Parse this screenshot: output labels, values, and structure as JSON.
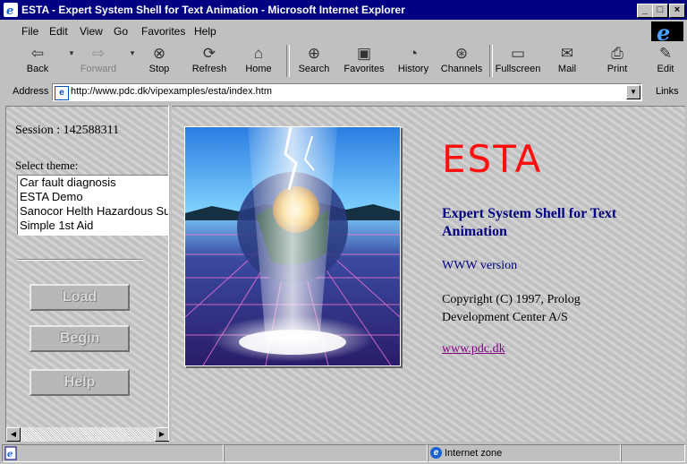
{
  "window": {
    "title": "ESTA - Expert System Shell for Text Animation - Microsoft Internet Explorer",
    "minimize": "_",
    "maximize": "□",
    "close": "×"
  },
  "menu": [
    "File",
    "Edit",
    "View",
    "Go",
    "Favorites",
    "Help"
  ],
  "toolbar": {
    "back": "Back",
    "forward": "Forward",
    "stop": "Stop",
    "refresh": "Refresh",
    "home": "Home",
    "search": "Search",
    "favorites": "Favorites",
    "history": "History",
    "channels": "Channels",
    "fullscreen": "Fullscreen",
    "mail": "Mail",
    "print": "Print",
    "edit": "Edit"
  },
  "address": {
    "label": "Address",
    "url": "http://www.pdc.dk/vipexamples/esta/index.htm",
    "links_label": "Links"
  },
  "left": {
    "session": "Session : 142588311",
    "select_theme": "Select theme:",
    "themes": [
      "Car fault diagnosis",
      "ESTA Demo",
      "Sanocor Helth Hazardous Sub",
      "Simple 1st Aid"
    ],
    "load_button": "Load",
    "begin_button": "Begin",
    "help_button": "Help"
  },
  "right": {
    "heading": "ESTA",
    "subtitle": "Expert System Shell for Text Animation",
    "version": "WWW version",
    "copyright": "Copyright (C) 1997, Prolog Development Center A/S",
    "link": "www.pdc.dk"
  },
  "status": {
    "zone": "Internet zone"
  },
  "colors": {
    "title_bar": "#000080",
    "heading": "#ff1010",
    "subtitle": "#000080",
    "link": "#800080"
  }
}
